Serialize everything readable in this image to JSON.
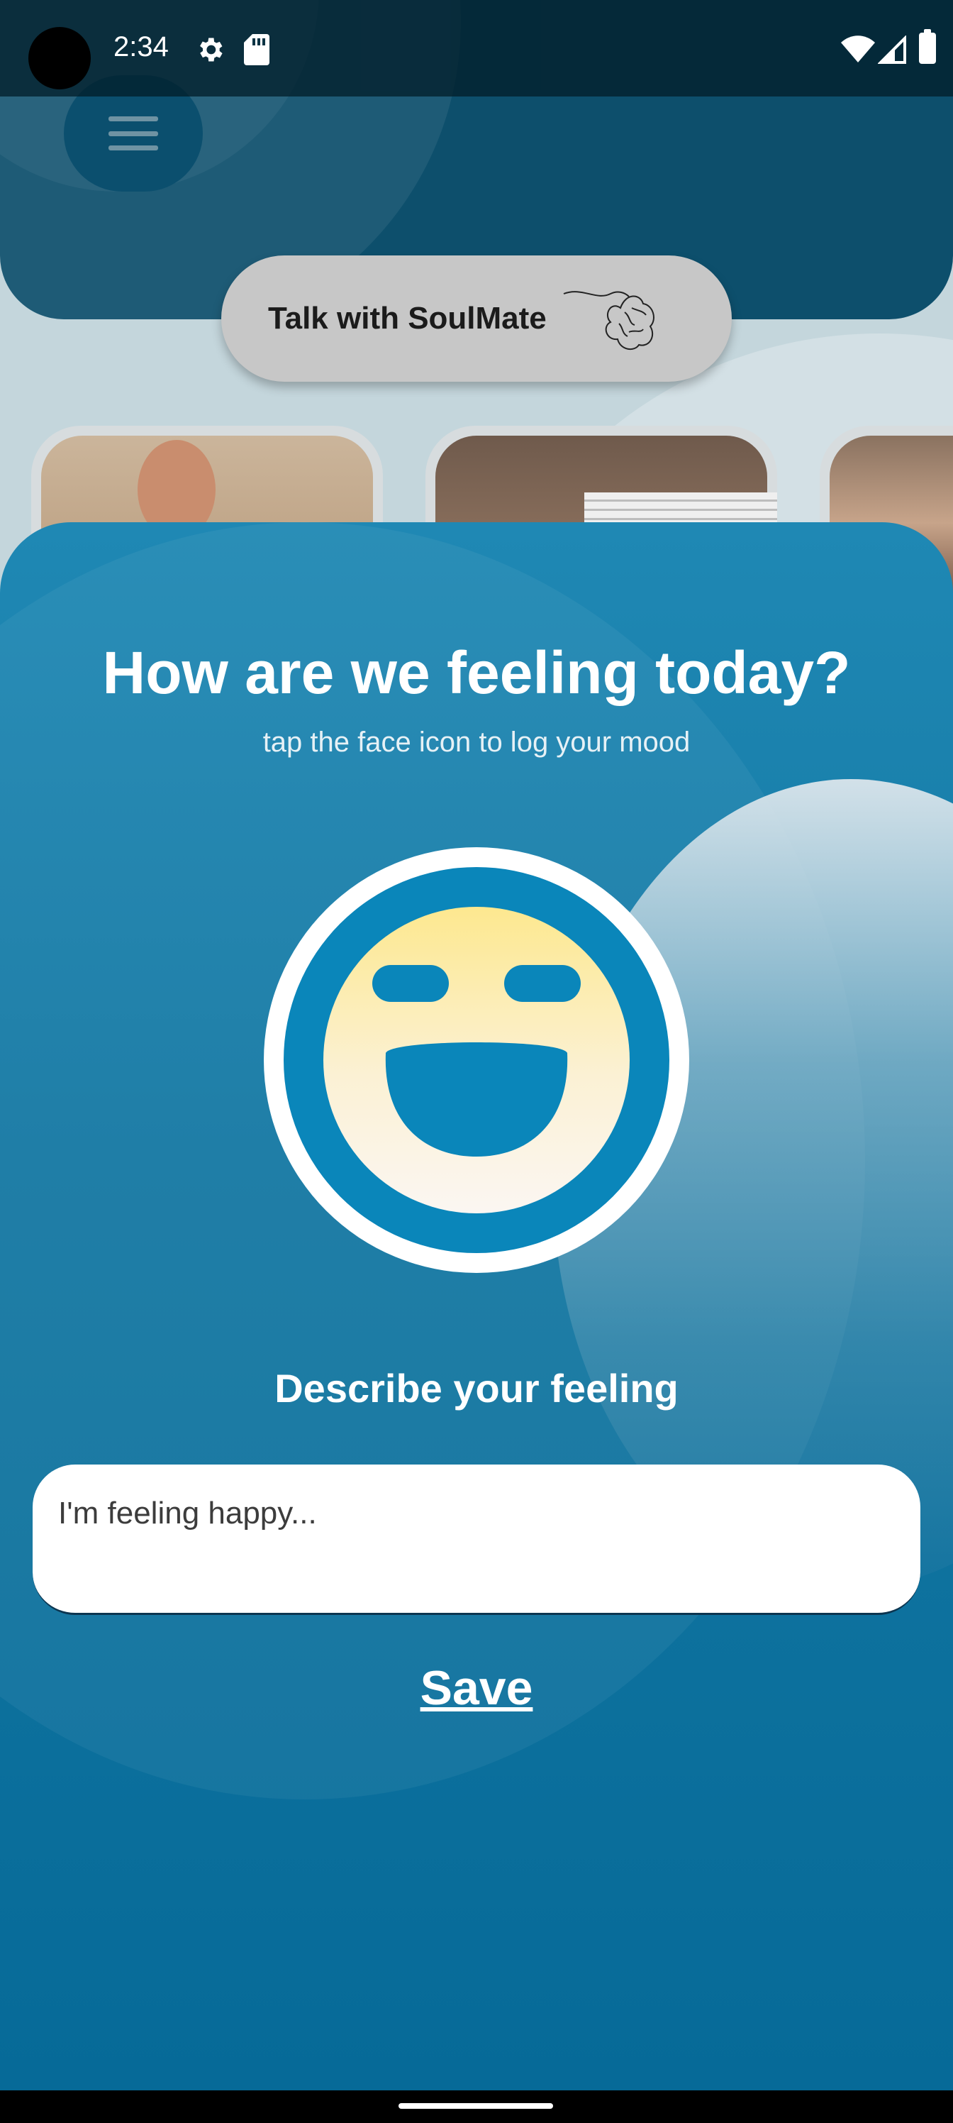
{
  "status_bar": {
    "time": "2:34",
    "icons": [
      "gear-icon",
      "sd-card-icon",
      "wifi-icon",
      "signal-icon",
      "battery-icon"
    ]
  },
  "background_page": {
    "menu_icon": "hamburger-menu-icon",
    "talk_button_label": "Talk with SoulMate",
    "talk_button_icon": "brain-icon"
  },
  "mood_sheet": {
    "title": "How are we feeling today?",
    "subtitle": "tap the face icon to log your mood",
    "mood_icon": "laughing-face-icon",
    "describe_label": "Describe your feeling",
    "input_placeholder": "I'm feeling happy...",
    "input_value": "",
    "save_label": "Save"
  },
  "colors": {
    "sheet_top": "#1f88b4",
    "sheet_bottom": "#066a98",
    "face_ring": "#0a86ba",
    "face_fill_top": "#fde88f",
    "face_fill_bottom": "#fbf6f2",
    "header": "#0d4f6c"
  }
}
